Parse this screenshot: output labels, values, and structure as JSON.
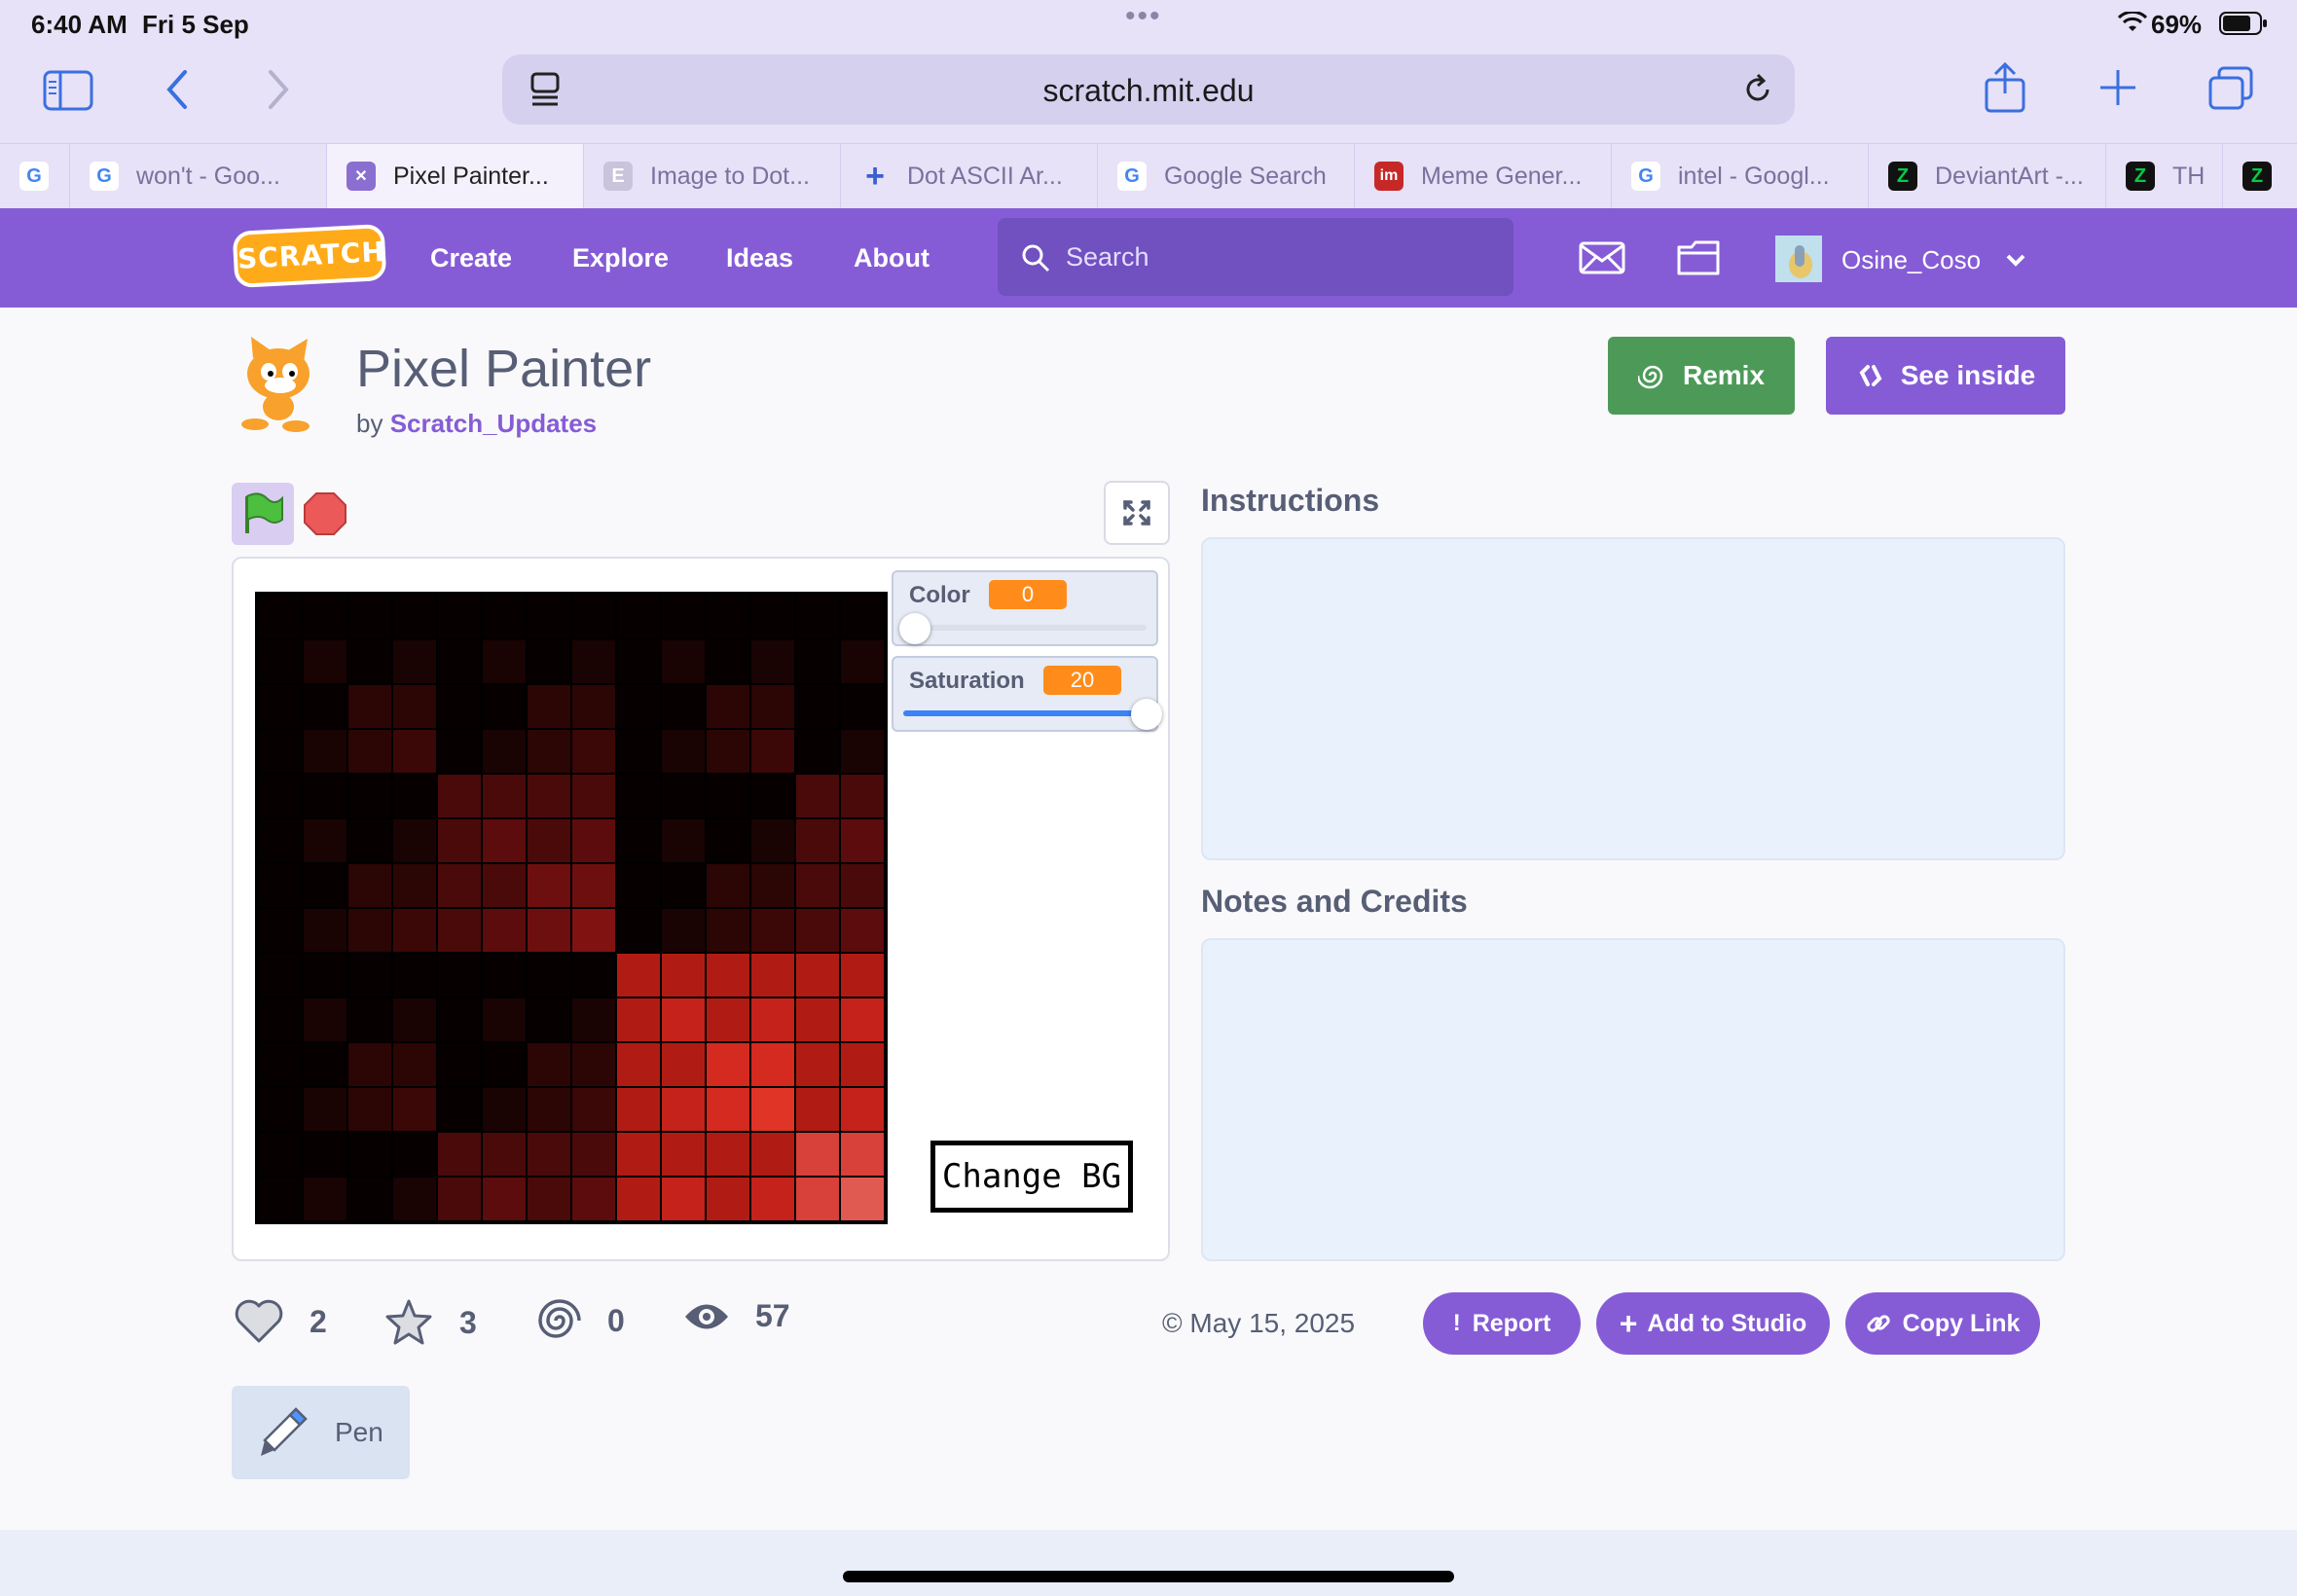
{
  "status_bar": {
    "time": "6:40 AM",
    "date": "Fri 5 Sep",
    "battery": "69%"
  },
  "browser": {
    "url": "scratch.mit.edu"
  },
  "tabs": [
    {
      "label": "",
      "icon": "G"
    },
    {
      "label": "won't - Goo...",
      "icon": "G"
    },
    {
      "label": "Pixel Painter...",
      "icon": "✕",
      "active": true
    },
    {
      "label": "Image to Dot...",
      "icon": "E"
    },
    {
      "label": "Dot ASCII Ar...",
      "icon": "+"
    },
    {
      "label": "Google Search",
      "icon": "G"
    },
    {
      "label": "Meme Gener...",
      "icon": "im"
    },
    {
      "label": "intel - Googl...",
      "icon": "G"
    },
    {
      "label": "DeviantArt -...",
      "icon": "Z"
    },
    {
      "label": "TH",
      "icon": "Z"
    },
    {
      "label": "",
      "icon": "Z"
    }
  ],
  "nav": {
    "logo": "SCRATCH",
    "create": "Create",
    "explore": "Explore",
    "ideas": "Ideas",
    "about": "About",
    "search_placeholder": "Search",
    "username": "Osine_Coso"
  },
  "project": {
    "title": "Pixel Painter",
    "by": "by",
    "author": "Scratch_Updates",
    "remix": "Remix",
    "see_inside": "See inside"
  },
  "stage": {
    "monitors": [
      {
        "label": "Color",
        "value": "0",
        "slider_fraction": 0.0
      },
      {
        "label": "Saturation",
        "value": "20",
        "slider_fraction": 1.0
      }
    ],
    "change_bg": "Change BG",
    "pixel_colors": [
      [
        "#060000",
        "#060000",
        "#060000",
        "#060000",
        "#060000",
        "#060000",
        "#060000",
        "#060000",
        "#060000",
        "#060000",
        "#060000",
        "#060000",
        "#060000",
        "#060000"
      ],
      [
        "#060000",
        "#1a0303",
        "#060000",
        "#1a0303",
        "#060000",
        "#1a0303",
        "#060000",
        "#1a0303",
        "#060000",
        "#1a0303",
        "#060000",
        "#1a0303",
        "#060000",
        "#1a0303"
      ],
      [
        "#060000",
        "#060000",
        "#2c0505",
        "#2c0505",
        "#060000",
        "#060000",
        "#2c0505",
        "#2c0505",
        "#060000",
        "#060000",
        "#2c0505",
        "#2c0505",
        "#060000",
        "#060000"
      ],
      [
        "#060000",
        "#1a0303",
        "#2c0505",
        "#3b0707",
        "#060000",
        "#1a0303",
        "#2c0505",
        "#3b0707",
        "#060000",
        "#1a0303",
        "#2c0505",
        "#3b0707",
        "#060000",
        "#1a0303"
      ],
      [
        "#060000",
        "#060000",
        "#060000",
        "#060000",
        "#4a0a0a",
        "#4a0a0a",
        "#4a0a0a",
        "#4a0a0a",
        "#060000",
        "#060000",
        "#060000",
        "#060000",
        "#4a0a0a",
        "#4a0a0a"
      ],
      [
        "#060000",
        "#1a0303",
        "#060000",
        "#1a0303",
        "#4a0a0a",
        "#5c0c0c",
        "#4a0a0a",
        "#5c0c0c",
        "#060000",
        "#1a0303",
        "#060000",
        "#1a0303",
        "#4a0a0a",
        "#5c0c0c"
      ],
      [
        "#060000",
        "#060000",
        "#2c0505",
        "#2c0505",
        "#4a0a0a",
        "#4a0a0a",
        "#6e0f0f",
        "#6e0f0f",
        "#060000",
        "#060000",
        "#2c0505",
        "#2c0505",
        "#4a0a0a",
        "#4a0a0a"
      ],
      [
        "#060000",
        "#1a0303",
        "#2c0505",
        "#3b0707",
        "#4a0a0a",
        "#5c0c0c",
        "#6e0f0f",
        "#801212",
        "#060000",
        "#1a0303",
        "#2c0505",
        "#3b0707",
        "#4a0a0a",
        "#5c0c0c"
      ],
      [
        "#060000",
        "#060000",
        "#060000",
        "#060000",
        "#060000",
        "#060000",
        "#060000",
        "#060000",
        "#b01c14",
        "#b01c14",
        "#b01c14",
        "#b01c14",
        "#b01c14",
        "#b01c14"
      ],
      [
        "#060000",
        "#1a0303",
        "#060000",
        "#1a0303",
        "#060000",
        "#1a0303",
        "#060000",
        "#1a0303",
        "#b01c14",
        "#c4221a",
        "#b01c14",
        "#c4221a",
        "#b01c14",
        "#c4221a"
      ],
      [
        "#060000",
        "#060000",
        "#2c0505",
        "#2c0505",
        "#060000",
        "#060000",
        "#2c0505",
        "#2c0505",
        "#b01c14",
        "#b01c14",
        "#d42a1f",
        "#d42a1f",
        "#b01c14",
        "#b01c14"
      ],
      [
        "#060000",
        "#1a0303",
        "#2c0505",
        "#3b0707",
        "#060000",
        "#1a0303",
        "#2c0505",
        "#3b0707",
        "#b01c14",
        "#c4221a",
        "#d42a1f",
        "#e03426",
        "#b01c14",
        "#c4221a"
      ],
      [
        "#060000",
        "#060000",
        "#060000",
        "#060000",
        "#4a0a0a",
        "#4a0a0a",
        "#4a0a0a",
        "#4a0a0a",
        "#b01c14",
        "#b01c14",
        "#b01c14",
        "#b01c14",
        "#d8403a",
        "#d8403a"
      ],
      [
        "#060000",
        "#1a0303",
        "#060000",
        "#1a0303",
        "#4a0a0a",
        "#5c0c0c",
        "#4a0a0a",
        "#5c0c0c",
        "#b01c14",
        "#c4221a",
        "#b01c14",
        "#c4221a",
        "#d8403a",
        "#e05a52"
      ]
    ]
  },
  "sidebar": {
    "instructions": "Instructions",
    "notes": "Notes and Credits"
  },
  "stats": {
    "loves": "2",
    "favorites": "3",
    "remixes": "0",
    "views": "57"
  },
  "shared_date": "© May 15, 2025",
  "actions": {
    "report": "Report",
    "add_to_studio": "Add to Studio",
    "copy_link": "Copy Link"
  },
  "extension": "Pen"
}
